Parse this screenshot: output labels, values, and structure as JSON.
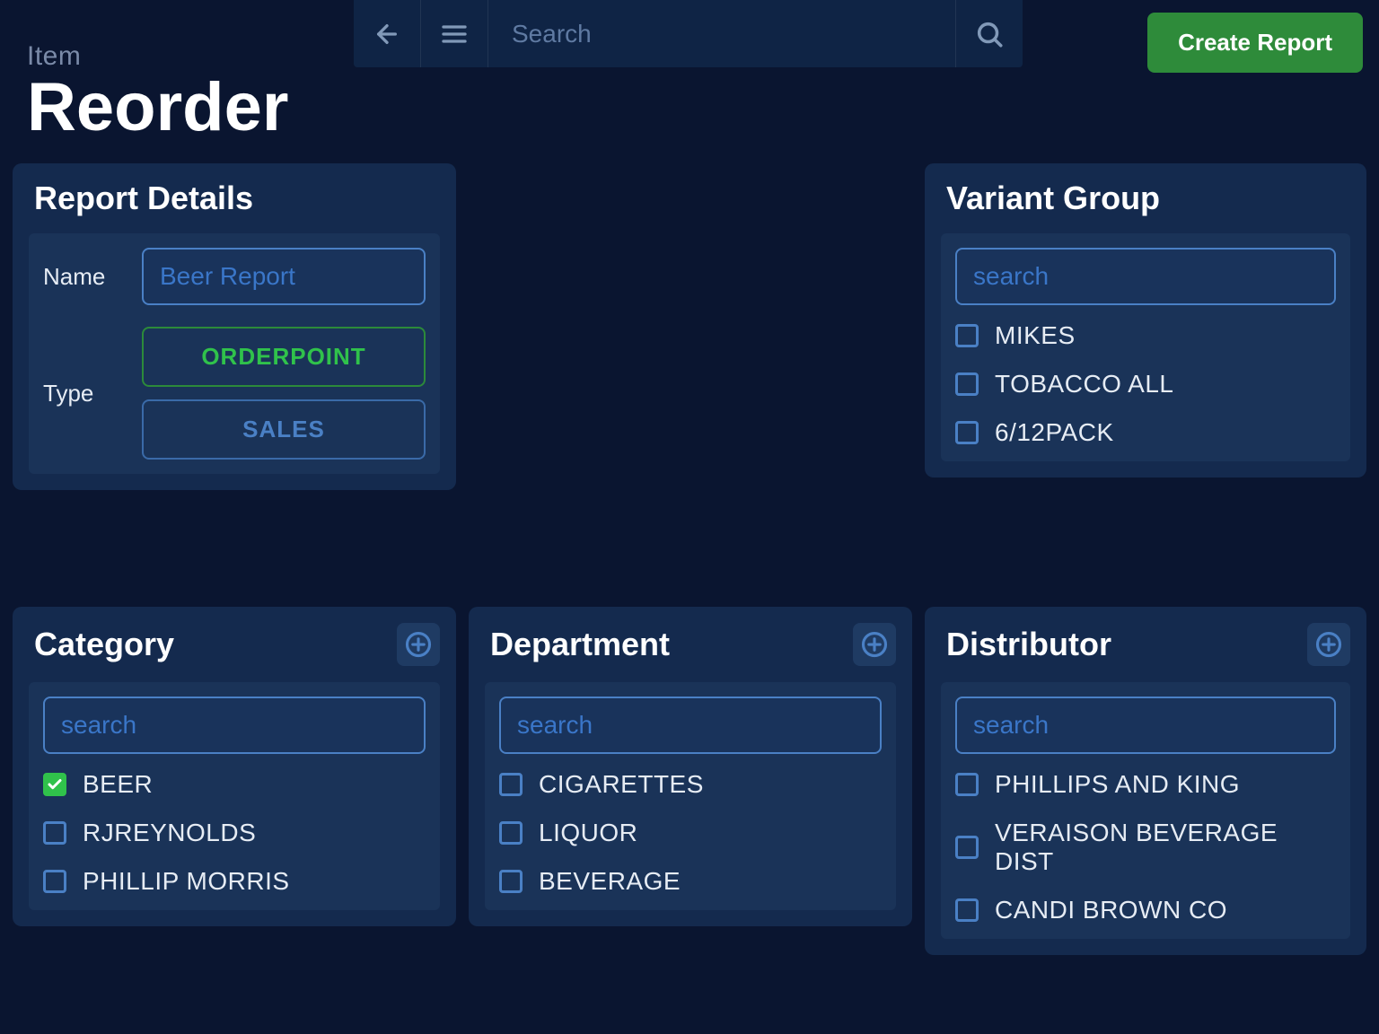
{
  "header": {
    "search_placeholder": "Search",
    "create_report_label": "Create Report"
  },
  "page": {
    "eyebrow": "Item",
    "title": "Reorder"
  },
  "report_details": {
    "card_title": "Report Details",
    "name_label": "Name",
    "name_value": "Beer Report",
    "type_label": "Type",
    "type_options": {
      "orderpoint": "ORDERPOINT",
      "sales": "SALES"
    }
  },
  "variant_group": {
    "card_title": "Variant Group",
    "search_placeholder": "search",
    "items": [
      {
        "label": "MIKES",
        "checked": false
      },
      {
        "label": "TOBACCO ALL",
        "checked": false
      },
      {
        "label": "6/12PACK",
        "checked": false
      }
    ]
  },
  "category": {
    "card_title": "Category",
    "search_placeholder": "search",
    "items": [
      {
        "label": "BEER",
        "checked": true
      },
      {
        "label": "RJREYNOLDS",
        "checked": false
      },
      {
        "label": "PHILLIP MORRIS",
        "checked": false
      }
    ]
  },
  "department": {
    "card_title": "Department",
    "search_placeholder": "search",
    "items": [
      {
        "label": "CIGARETTES",
        "checked": false
      },
      {
        "label": "LIQUOR",
        "checked": false
      },
      {
        "label": "BEVERAGE",
        "checked": false
      }
    ]
  },
  "distributor": {
    "card_title": "Distributor",
    "search_placeholder": "search",
    "items": [
      {
        "label": "PHILLIPS AND KING",
        "checked": false
      },
      {
        "label": "VERAISON BEVERAGE DIST",
        "checked": false
      },
      {
        "label": "CANDI BROWN CO",
        "checked": false
      }
    ]
  }
}
